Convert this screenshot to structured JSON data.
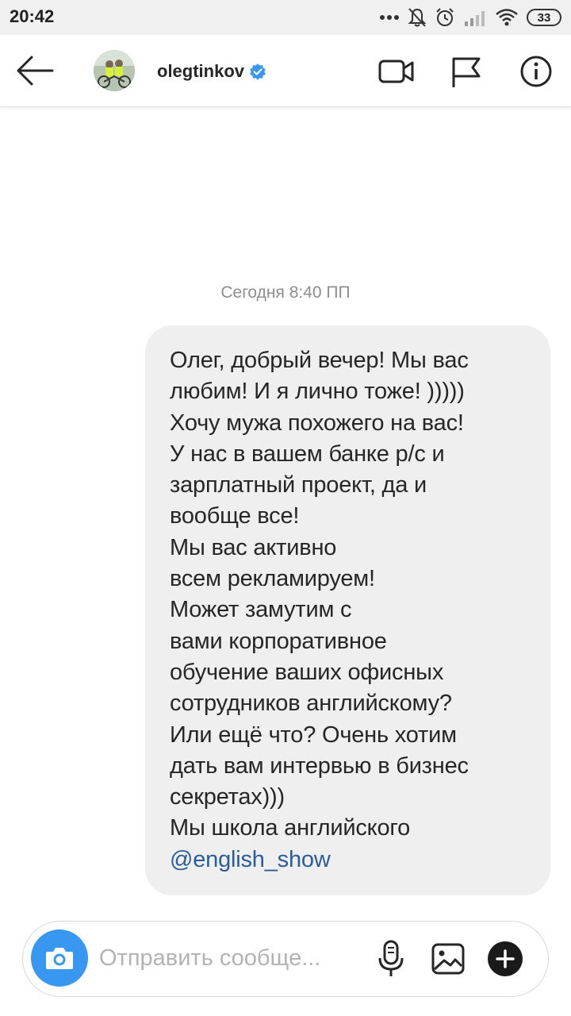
{
  "status_bar": {
    "time": "20:42",
    "battery": "33"
  },
  "header": {
    "username": "olegtinkov",
    "verified": true
  },
  "thread": {
    "date_label": "Сегодня 8:40 ПП",
    "message_lines": [
      "Олег, добрый вечер! Мы вас",
      "любим! И я лично тоже! )))))",
      "Хочу мужа похожего на вас!",
      "У нас в вашем банке р/с и",
      "зарплатный проект, да и",
      "вообще все!",
      "Мы вас активно",
      "всем рекламируем!",
      "Может замутим с",
      "вами корпоративное",
      "обучение ваших офисных",
      "сотрудников английскому?",
      "Или ещё что? Очень хотим",
      "дать вам интервью в бизнес",
      "секретах)))",
      "Мы школа английского"
    ],
    "message_mention": "@english_show"
  },
  "composer": {
    "placeholder": "Отправить сообще..."
  },
  "colors": {
    "accent": "#3897f0",
    "bubble": "#efefef",
    "mention": "#2a5d9c",
    "timestamp": "#8e8e8e"
  },
  "icons": {
    "header": [
      "back-arrow-icon",
      "video-call-icon",
      "flag-icon",
      "info-icon"
    ],
    "composer": [
      "camera-icon",
      "microphone-icon",
      "gallery-icon",
      "plus-icon"
    ]
  }
}
